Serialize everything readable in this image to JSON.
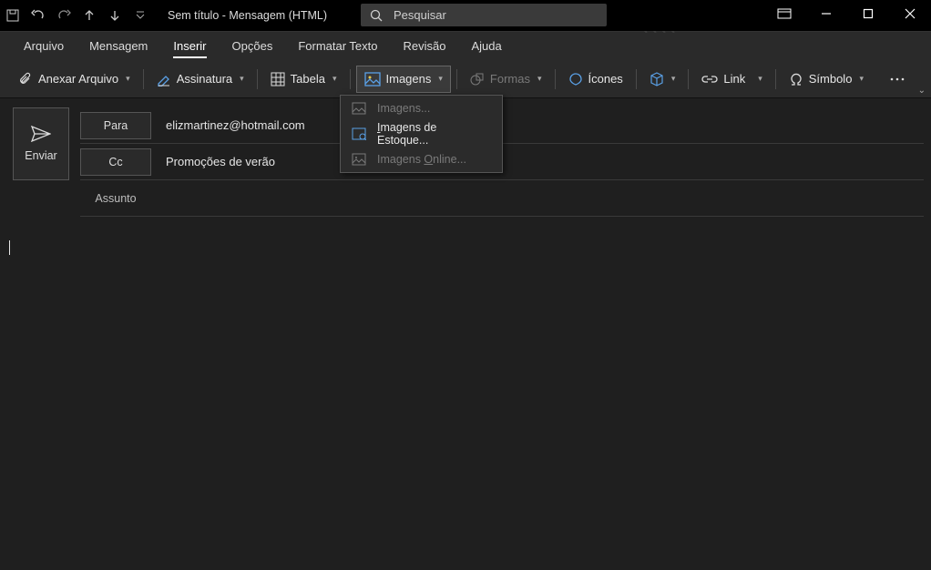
{
  "window": {
    "title": "Sem título  -  Mensagem (HTML)",
    "search_placeholder": "Pesquisar"
  },
  "tabs": {
    "arquivo": "Arquivo",
    "mensagem": "Mensagem",
    "inserir": "Inserir",
    "opcoes": "Opções",
    "formatar": "Formatar Texto",
    "revisao": "Revisão",
    "ajuda": "Ajuda",
    "active": "inserir"
  },
  "ribbon": {
    "anexar": "Anexar Arquivo",
    "assinatura": "Assinatura",
    "tabela": "Tabela",
    "imagens": "Imagens",
    "formas": "Formas",
    "icones": "Ícones",
    "link": "Link",
    "simbolo": "Símbolo"
  },
  "dropdown": {
    "imagens": "Imagens...",
    "estoque": "Imagens de Estoque...",
    "online": "Imagens Online..."
  },
  "compose": {
    "enviar": "Enviar",
    "para_label": "Para",
    "cc_label": "Cc",
    "assunto_label": "Assunto",
    "para_value": "elizmartinez@hotmail.com",
    "cc_value": "Promoções de verão",
    "assunto_value": ""
  }
}
